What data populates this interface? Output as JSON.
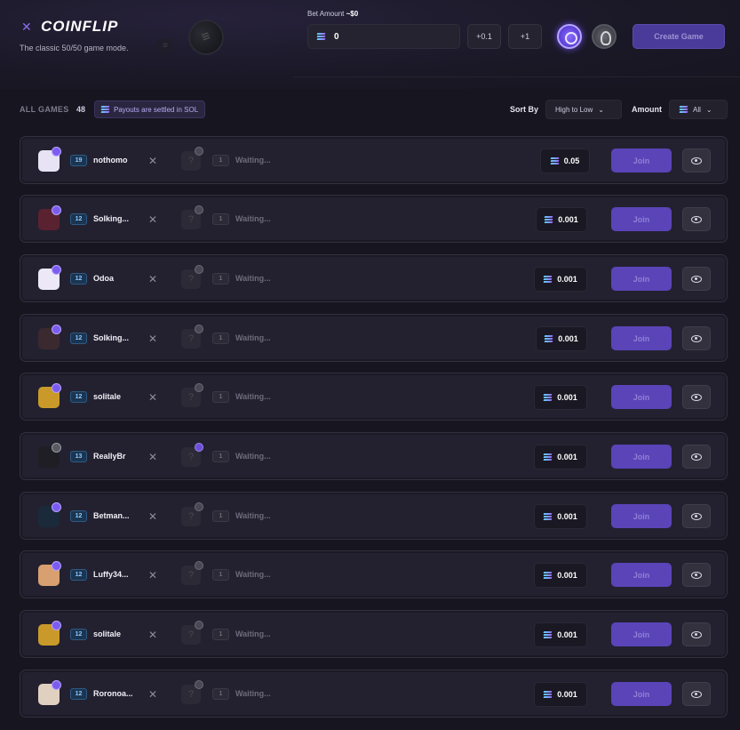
{
  "header": {
    "title": "COINFLIP",
    "subtitle": "The classic 50/50 game mode.",
    "bet_label": "Bet Amount",
    "bet_usd": "~$0",
    "bet_value": "0",
    "step1": "+0.1",
    "step2": "+1",
    "create_label": "Create Game"
  },
  "filters": {
    "all_games_label": "ALL GAMES",
    "all_games_count": "48",
    "payout_text": "Payouts are settled in SOL",
    "sort_label": "Sort By",
    "sort_value": "High to Low",
    "amount_label": "Amount",
    "amount_value": "All"
  },
  "games": [
    {
      "level": "19",
      "name": "nothomo",
      "opp_level": "1",
      "status": "Waiting...",
      "amount": "0.05",
      "join": "Join"
    },
    {
      "level": "12",
      "name": "Solking...",
      "opp_level": "1",
      "status": "Waiting...",
      "amount": "0.001",
      "join": "Join"
    },
    {
      "level": "12",
      "name": "Odoa",
      "opp_level": "1",
      "status": "Waiting...",
      "amount": "0.001",
      "join": "Join"
    },
    {
      "level": "12",
      "name": "Solking...",
      "opp_level": "1",
      "status": "Waiting...",
      "amount": "0.001",
      "join": "Join"
    },
    {
      "level": "12",
      "name": "solitale",
      "opp_level": "1",
      "status": "Waiting...",
      "amount": "0.001",
      "join": "Join"
    },
    {
      "level": "13",
      "name": "ReallyBr",
      "opp_level": "1",
      "status": "Waiting...",
      "amount": "0.001",
      "join": "Join"
    },
    {
      "level": "12",
      "name": "Betman...",
      "opp_level": "1",
      "status": "Waiting...",
      "amount": "0.001",
      "join": "Join"
    },
    {
      "level": "12",
      "name": "Luffy34...",
      "opp_level": "1",
      "status": "Waiting...",
      "amount": "0.001",
      "join": "Join"
    },
    {
      "level": "12",
      "name": "solitale",
      "opp_level": "1",
      "status": "Waiting...",
      "amount": "0.001",
      "join": "Join"
    },
    {
      "level": "12",
      "name": "Roronoa...",
      "opp_level": "1",
      "status": "Waiting...",
      "amount": "0.001",
      "join": "Join"
    }
  ],
  "colors": {
    "accent": "#5a44b8",
    "background": "#17151f",
    "row": "#232130"
  }
}
